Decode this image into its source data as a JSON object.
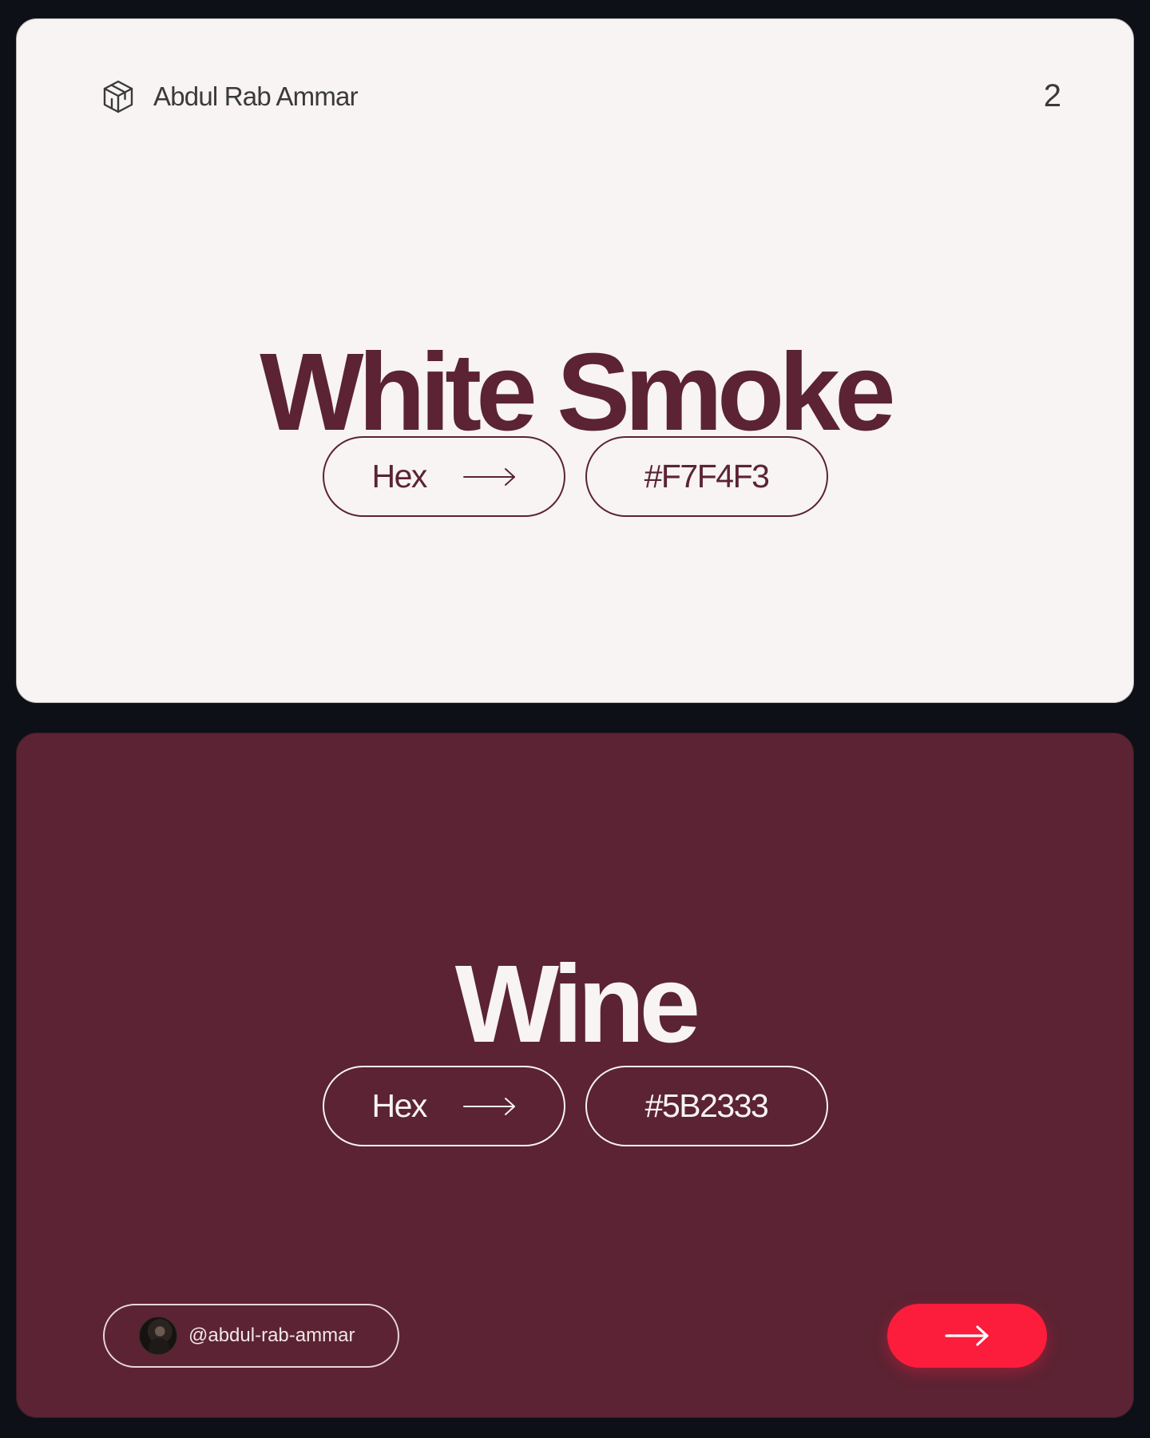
{
  "header": {
    "brand_name": "Abdul Rab Ammar",
    "brand_icon": "cube-icon",
    "page_number": "2"
  },
  "colors": {
    "white_smoke": "#F7F4F3",
    "wine": "#5B2333",
    "accent": "#FC1C3C",
    "background": "#0D1016"
  },
  "swatches": [
    {
      "name": "White Smoke",
      "label": "Hex",
      "value": "#F7F4F3"
    },
    {
      "name": "Wine",
      "label": "Hex",
      "value": "#5B2333"
    }
  ],
  "footer": {
    "handle": "@abdul-rab-ammar",
    "avatar_icon": "avatar",
    "next_icon": "arrow-right-icon"
  }
}
